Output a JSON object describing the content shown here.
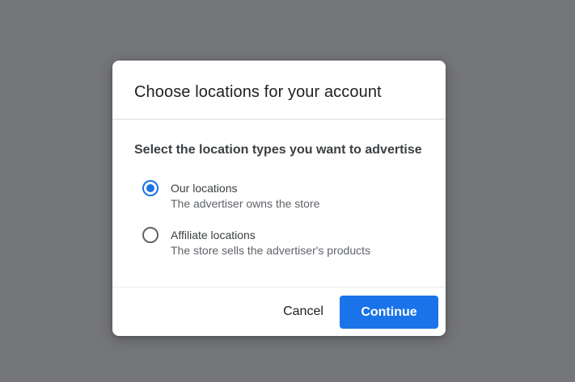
{
  "dialog": {
    "title": "Choose locations for your account",
    "section_heading": "Select the location types you want to advertise",
    "options": [
      {
        "label": "Our locations",
        "description": "The advertiser owns the store",
        "selected": true
      },
      {
        "label": "Affiliate locations",
        "description": "The store sells the advertiser's products",
        "selected": false
      }
    ],
    "cancel_label": "Cancel",
    "continue_label": "Continue"
  },
  "colors": {
    "overlay": "#75767a",
    "accent": "#1a73e8",
    "title_text": "#202124",
    "secondary_text": "#5f6368"
  }
}
